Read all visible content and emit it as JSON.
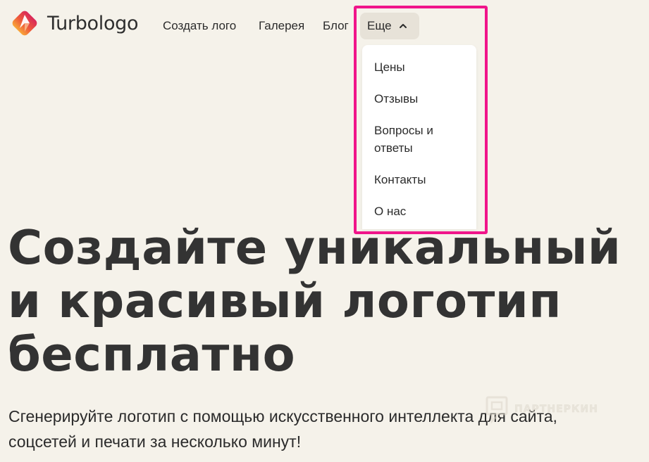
{
  "brand": {
    "name": "Turbologo",
    "logo_icon": "turbologo-diamond-icon",
    "colors": {
      "logo_top": "#e3364f",
      "logo_bottom": "#f6a23a"
    }
  },
  "nav": {
    "items": [
      {
        "label": "Создать лого"
      },
      {
        "label": "Галерея"
      },
      {
        "label": "Блог"
      }
    ],
    "more": {
      "label": "Еще",
      "icon": "chevron-up-icon",
      "expanded": true
    }
  },
  "dropdown": {
    "items": [
      {
        "label": "Цены"
      },
      {
        "label": "Отзывы"
      },
      {
        "label": "Вопросы и ответы"
      },
      {
        "label": "Контакты"
      },
      {
        "label": "О нас"
      }
    ]
  },
  "hero": {
    "title": "Создайте уникальный и красивый логотип бесплатно",
    "subtitle": "Сгенерируйте логотип с помощью искусственного интеллекта для сайта, соцсетей и печати за несколько минут!"
  },
  "watermark": {
    "text": "ПАРТНЕРКИН",
    "icon": "partnerkin-icon"
  },
  "highlight_color": "#f0158a",
  "background_color": "#f5f2ea"
}
